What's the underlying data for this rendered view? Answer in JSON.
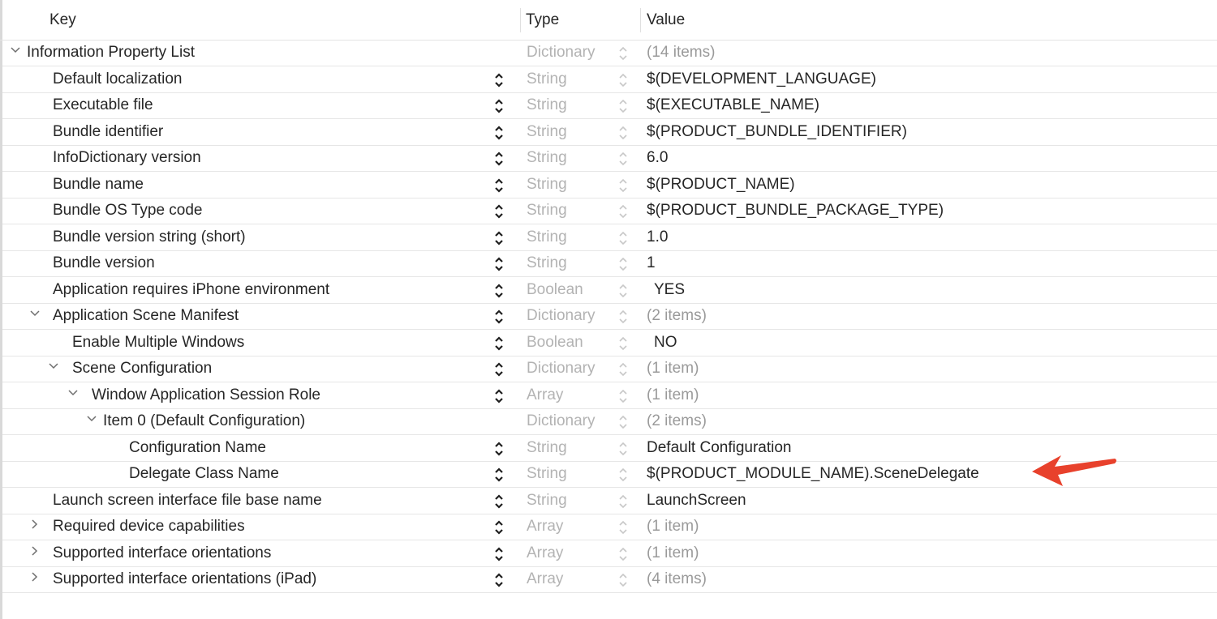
{
  "header": {
    "key": "Key",
    "type": "Type",
    "value": "Value"
  },
  "rows": [
    {
      "key": "Information Property List",
      "indent": 0,
      "disclosure": "expanded",
      "stepper": false,
      "type": "Dictionary",
      "value": "(14 items)"
    },
    {
      "key": "Default localization",
      "indent": 1,
      "disclosure": "none",
      "stepper": true,
      "type": "String",
      "value": "$(DEVELOPMENT_LANGUAGE)"
    },
    {
      "key": "Executable file",
      "indent": 1,
      "disclosure": "none",
      "stepper": true,
      "type": "String",
      "value": "$(EXECUTABLE_NAME)"
    },
    {
      "key": "Bundle identifier",
      "indent": 1,
      "disclosure": "none",
      "stepper": true,
      "type": "String",
      "value": "$(PRODUCT_BUNDLE_IDENTIFIER)"
    },
    {
      "key": "InfoDictionary version",
      "indent": 1,
      "disclosure": "none",
      "stepper": true,
      "type": "String",
      "value": "6.0"
    },
    {
      "key": "Bundle name",
      "indent": 1,
      "disclosure": "none",
      "stepper": true,
      "type": "String",
      "value": "$(PRODUCT_NAME)"
    },
    {
      "key": "Bundle OS Type code",
      "indent": 1,
      "disclosure": "none",
      "stepper": true,
      "type": "String",
      "value": "$(PRODUCT_BUNDLE_PACKAGE_TYPE)"
    },
    {
      "key": "Bundle version string (short)",
      "indent": 1,
      "disclosure": "none",
      "stepper": true,
      "type": "String",
      "value": "1.0"
    },
    {
      "key": "Bundle version",
      "indent": 1,
      "disclosure": "none",
      "stepper": true,
      "type": "String",
      "value": "1"
    },
    {
      "key": "Application requires iPhone environment",
      "indent": 1,
      "disclosure": "none",
      "stepper": true,
      "type": "Boolean",
      "value": "YES"
    },
    {
      "key": "Application Scene Manifest",
      "indent": 1,
      "disclosure": "expanded",
      "stepper": true,
      "type": "Dictionary",
      "value": "(2 items)"
    },
    {
      "key": "Enable Multiple Windows",
      "indent": 2,
      "disclosure": "none",
      "stepper": true,
      "type": "Boolean",
      "value": "NO"
    },
    {
      "key": "Scene Configuration",
      "indent": 2,
      "disclosure": "expanded",
      "stepper": true,
      "type": "Dictionary",
      "value": "(1 item)"
    },
    {
      "key": "Window Application Session Role",
      "indent": 3,
      "disclosure": "expanded",
      "stepper": true,
      "type": "Array",
      "value": "(1 item)"
    },
    {
      "key": "Item 0 (Default Configuration)",
      "indent": 4,
      "disclosure": "expanded",
      "stepper": false,
      "type": "Dictionary",
      "value": "(2 items)"
    },
    {
      "key": "Configuration Name",
      "indent": 5,
      "disclosure": "none",
      "stepper": true,
      "type": "String",
      "value": "Default Configuration"
    },
    {
      "key": "Delegate Class Name",
      "indent": 5,
      "disclosure": "none",
      "stepper": true,
      "type": "String",
      "value": "$(PRODUCT_MODULE_NAME).SceneDelegate"
    },
    {
      "key": "Launch screen interface file base name",
      "indent": 1,
      "disclosure": "none",
      "stepper": true,
      "type": "String",
      "value": "LaunchScreen"
    },
    {
      "key": "Required device capabilities",
      "indent": 1,
      "disclosure": "collapsed",
      "stepper": true,
      "type": "Array",
      "value": "(1 item)"
    },
    {
      "key": "Supported interface orientations",
      "indent": 1,
      "disclosure": "collapsed",
      "stepper": true,
      "type": "Array",
      "value": "(1 item)"
    },
    {
      "key": "Supported interface orientations (iPad)",
      "indent": 1,
      "disclosure": "collapsed",
      "stepper": true,
      "type": "Array",
      "value": "(4 items)"
    }
  ],
  "annotation": {
    "icon": "red-arrow-icon",
    "color": "#e8412c",
    "points_to": "Delegate Class Name"
  }
}
